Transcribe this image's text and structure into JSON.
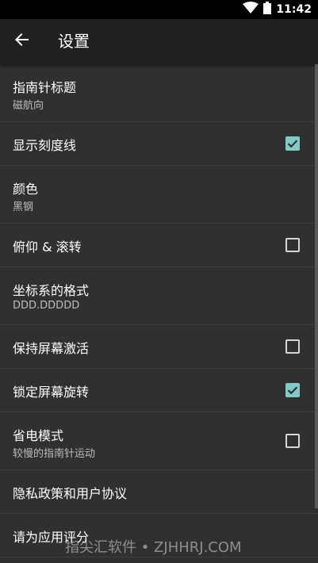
{
  "status": {
    "time": "11:42"
  },
  "toolbar": {
    "title": "设置"
  },
  "settings": [
    {
      "title": "指南针标题",
      "summary": "磁航向"
    },
    {
      "title": "显示刻度线",
      "checked": true
    },
    {
      "title": "颜色",
      "summary": "黑钢"
    },
    {
      "title": "俯仰 & 滚转",
      "checked": false
    },
    {
      "title": "坐标系的格式",
      "summary": "DDD.DDDDD"
    },
    {
      "title": "保持屏幕激活",
      "checked": false
    },
    {
      "title": "锁定屏幕旋转",
      "checked": true
    },
    {
      "title": "省电模式",
      "summary": "较慢的指南针运动",
      "checked": false
    },
    {
      "title": "隐私政策和用户协议"
    },
    {
      "title": "请为应用评分"
    }
  ],
  "watermark": "指尖汇软件 • ZJHHRJ.COM",
  "colors": {
    "accent": "#80cbc4",
    "toolbar": "#212121",
    "background": "#303030"
  }
}
